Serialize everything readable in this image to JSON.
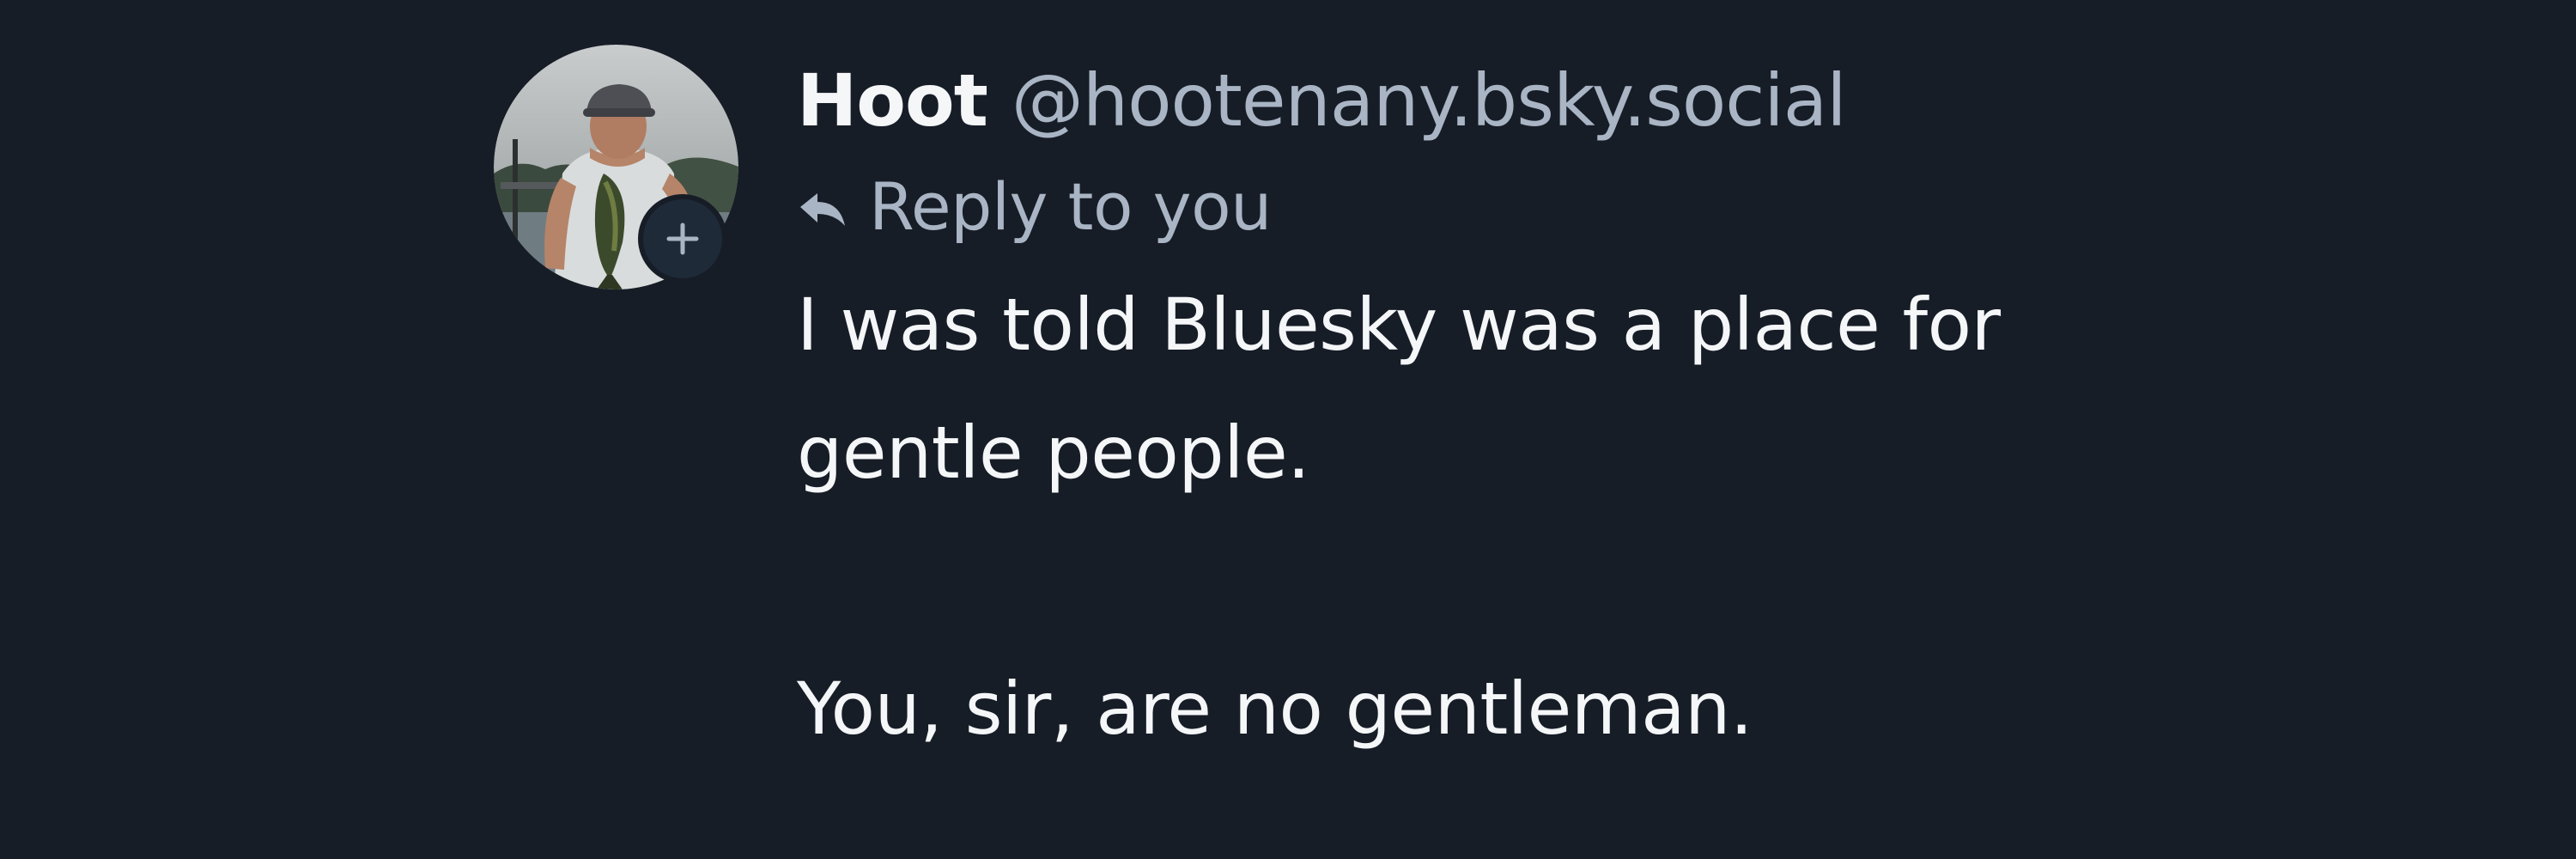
{
  "post": {
    "author": {
      "display_name": "Hoot",
      "handle": "@hootenany.bsky.social",
      "avatar_icon": "fisherman-avatar",
      "follow_icon": "plus-icon"
    },
    "reply_context": {
      "icon": "reply-arrow-icon",
      "label": "Reply to you"
    },
    "text_lines": [
      "I was told Bluesky was a place for",
      "gentle people.",
      "",
      "You, sir, are no gentleman."
    ]
  },
  "colors": {
    "background": "#171d27",
    "primary_text": "#f4f6f8",
    "secondary_text": "#a9b5c4",
    "follow_badge": "#1e2a38"
  }
}
